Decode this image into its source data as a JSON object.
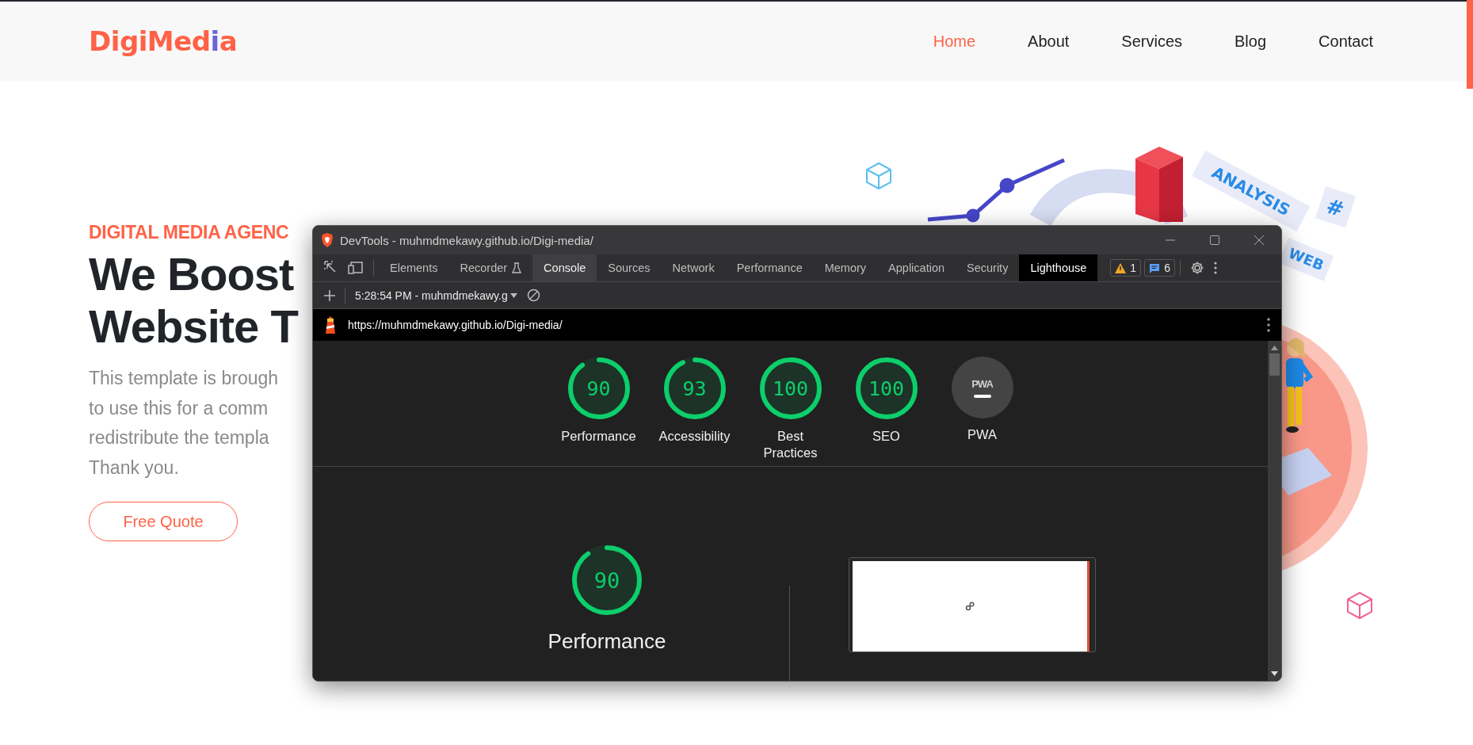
{
  "header": {
    "logo": [
      {
        "text": "DigiMed",
        "color": "#ff6247"
      },
      {
        "text": "i",
        "color": "#6b63d6"
      },
      {
        "text": "a",
        "color": "#ff6247"
      }
    ],
    "nav": [
      {
        "label": "Home",
        "selected": true
      },
      {
        "label": "About",
        "selected": false
      },
      {
        "label": "Services",
        "selected": false
      },
      {
        "label": "Blog",
        "selected": false
      },
      {
        "label": "Contact",
        "selected": false
      }
    ]
  },
  "hero": {
    "eyebrow": "DIGITAL MEDIA AGENC",
    "title_lines": [
      "We Boost",
      "Website T"
    ],
    "paragraph_lines": [
      "This template is brough",
      "to use this for a comm",
      "redistribute the templa",
      "Thank you."
    ],
    "button": "Free Quote",
    "illustration": {
      "labels": [
        "ANALYSIS",
        "#",
        "WEB"
      ]
    }
  },
  "devtools": {
    "title": "DevTools - muhmdmekawy.github.io/Digi-media/",
    "tabs": [
      {
        "label": "Elements",
        "selected": false,
        "highlighted": false,
        "experimental": false
      },
      {
        "label": "Recorder",
        "selected": false,
        "highlighted": false,
        "experimental": true
      },
      {
        "label": "Console",
        "selected": false,
        "highlighted": true,
        "experimental": false
      },
      {
        "label": "Sources",
        "selected": false,
        "highlighted": false,
        "experimental": false
      },
      {
        "label": "Network",
        "selected": false,
        "highlighted": false,
        "experimental": false
      },
      {
        "label": "Performance",
        "selected": false,
        "highlighted": false,
        "experimental": false
      },
      {
        "label": "Memory",
        "selected": false,
        "highlighted": false,
        "experimental": false
      },
      {
        "label": "Application",
        "selected": false,
        "highlighted": false,
        "experimental": false
      },
      {
        "label": "Security",
        "selected": false,
        "highlighted": false,
        "experimental": false
      },
      {
        "label": "Lighthouse",
        "selected": true,
        "highlighted": false,
        "experimental": false
      }
    ],
    "badges": [
      {
        "kind": "warning",
        "count": "1"
      },
      {
        "kind": "message",
        "count": "6"
      }
    ],
    "context": "5:28:54 PM - muhmdmekawy.g",
    "url": "https://muhmdmekawy.github.io/Digi-media/",
    "scores": [
      {
        "kind": "gauge",
        "score": "90",
        "level": 0.9,
        "label": "Performance"
      },
      {
        "kind": "gauge",
        "score": "93",
        "level": 0.93,
        "label": "Accessibility"
      },
      {
        "kind": "gauge",
        "score": "100",
        "level": 1,
        "label": "Best Practices"
      },
      {
        "kind": "gauge",
        "score": "100",
        "level": 1,
        "label": "SEO"
      },
      {
        "kind": "pwa",
        "logo": "PWA",
        "label": "PWA"
      }
    ],
    "main_score": {
      "score": "90",
      "level": 0.9,
      "label": "Performance"
    }
  }
}
